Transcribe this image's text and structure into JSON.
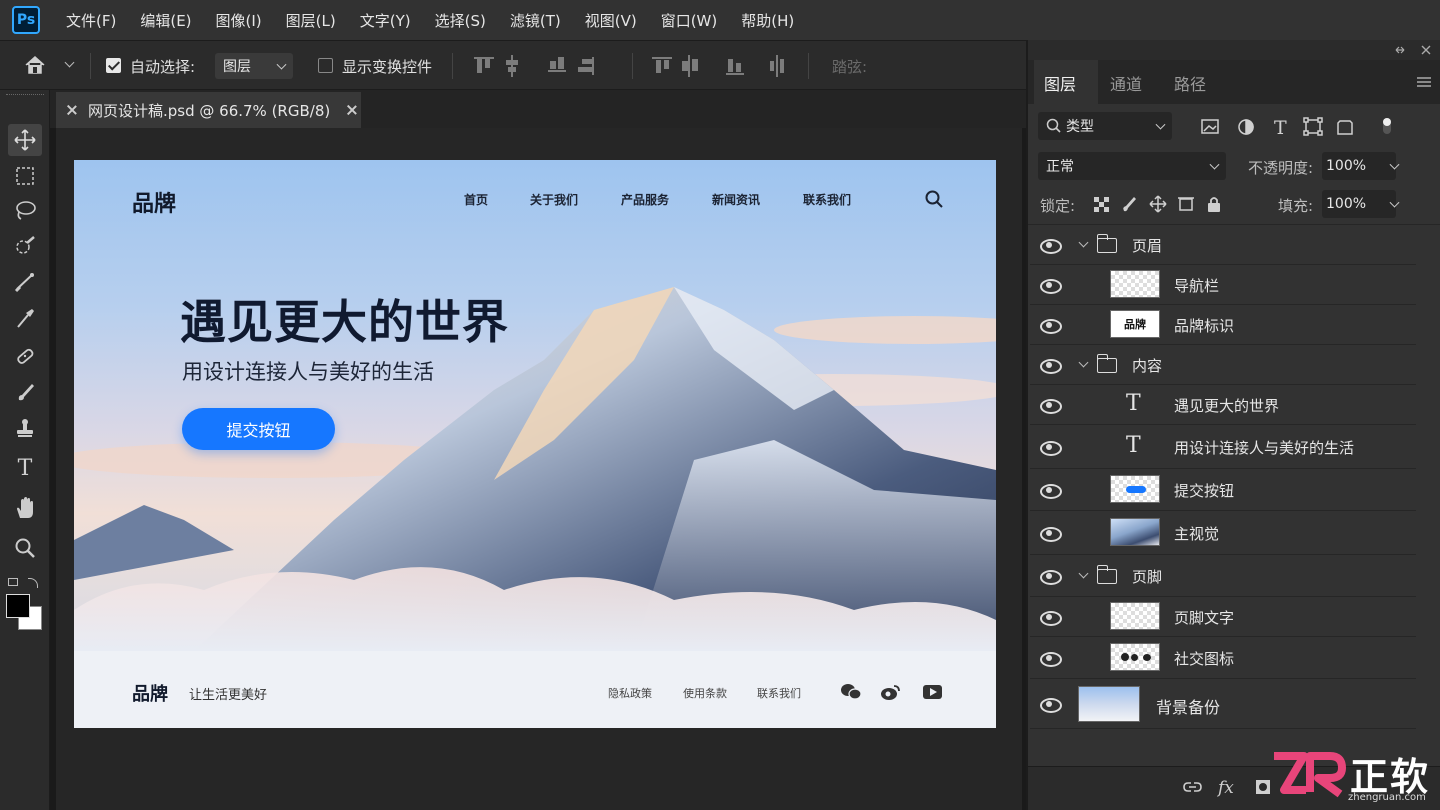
{
  "app": {
    "logo": "Ps"
  },
  "menu": [
    "文件(F)",
    "编辑(E)",
    "图像(I)",
    "图层(L)",
    "文字(Y)",
    "选择(S)",
    "滤镜(T)",
    "视图(V)",
    "窗口(W)",
    "帮助(H)"
  ],
  "options": {
    "auto_select_label": "自动选择:",
    "auto_select_checked": true,
    "auto_select_target": "图层",
    "show_transform_label": "显示变换控件",
    "show_transform_checked": false,
    "distribute_label": "踏弦:"
  },
  "document": {
    "tab_title": "网页设计稿.psd @ 66.7% (RGB/8)"
  },
  "canvas": {
    "brand": "品牌",
    "nav": [
      "首页",
      "关于我们",
      "产品服务",
      "新闻资讯",
      "联系我们"
    ],
    "headline": "遇见更大的世界",
    "subheadline": "用设计连接人与美好的生活",
    "cta": "提交按钮",
    "footer": {
      "brand": "品牌",
      "slogan": "让生活更美好",
      "links": [
        "隐私政策",
        "使用条款",
        "联系我们"
      ]
    }
  },
  "panel": {
    "tabs": [
      "图层",
      "通道",
      "路径"
    ],
    "filter_kind": "类型",
    "blend_mode": "正常",
    "opacity_label": "不透明度:",
    "opacity_value": "100%",
    "lock_label": "锁定:",
    "fill_label": "填充:",
    "fill_value": "100%",
    "layers": [
      {
        "name": "页眉",
        "kind": "group"
      },
      {
        "name": "导航栏",
        "kind": "image"
      },
      {
        "name": "品牌标识",
        "kind": "image",
        "thumb_text": "品牌"
      },
      {
        "name": "内容",
        "kind": "group"
      },
      {
        "name": "遇见更大的世界",
        "kind": "text"
      },
      {
        "name": "用设计连接人与美好的生活",
        "kind": "text"
      },
      {
        "name": "提交按钮",
        "kind": "image"
      },
      {
        "name": "主视觉",
        "kind": "image"
      },
      {
        "name": "页脚",
        "kind": "group"
      },
      {
        "name": "页脚文字",
        "kind": "image"
      },
      {
        "name": "社交图标",
        "kind": "image"
      },
      {
        "name": "背景备份",
        "kind": "image"
      }
    ]
  },
  "watermark": {
    "text": "正软",
    "site": "zhengruan.com"
  },
  "colors": {
    "accent": "#1677ff",
    "ps_blue": "#31a8ff",
    "panel_bg": "#2b2b2b"
  }
}
